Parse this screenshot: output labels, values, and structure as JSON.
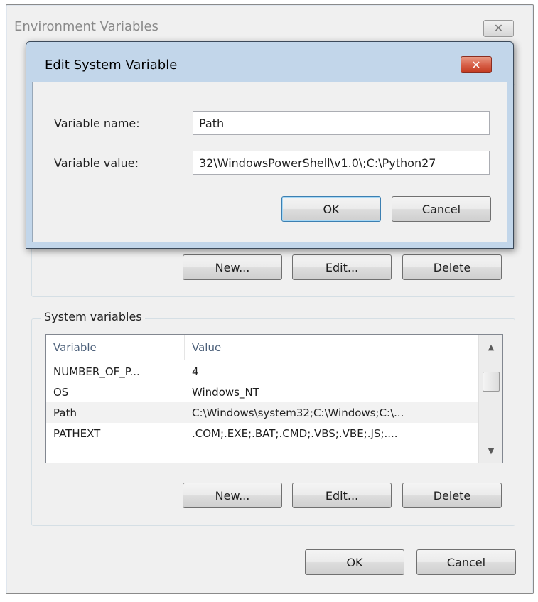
{
  "env_dialog": {
    "title": "Environment Variables",
    "close_label": "✕",
    "user_buttons": {
      "new": "New...",
      "edit": "Edit...",
      "delete": "Delete"
    },
    "system_variables": {
      "group_label": "System variables",
      "columns": [
        "Variable",
        "Value"
      ],
      "rows": [
        {
          "variable": "NUMBER_OF_P...",
          "value": "4"
        },
        {
          "variable": "OS",
          "value": "Windows_NT"
        },
        {
          "variable": "Path",
          "value": "C:\\Windows\\system32;C:\\Windows;C:\\...",
          "selected": true
        },
        {
          "variable": "PATHEXT",
          "value": ".COM;.EXE;.BAT;.CMD;.VBS;.VBE;.JS;...."
        }
      ],
      "buttons": {
        "new": "New...",
        "edit": "Edit...",
        "delete": "Delete"
      }
    },
    "ok_label": "OK",
    "cancel_label": "Cancel"
  },
  "edit_dialog": {
    "title": "Edit System Variable",
    "close_label": "✕",
    "name_label": "Variable name:",
    "name_value": "Path",
    "value_label": "Variable value:",
    "value_value": "32\\WindowsPowerShell\\v1.0\\;C:\\Python27",
    "ok_label": "OK",
    "cancel_label": "Cancel"
  },
  "icons": {
    "scroll_up": "▲",
    "scroll_down": "▼"
  }
}
